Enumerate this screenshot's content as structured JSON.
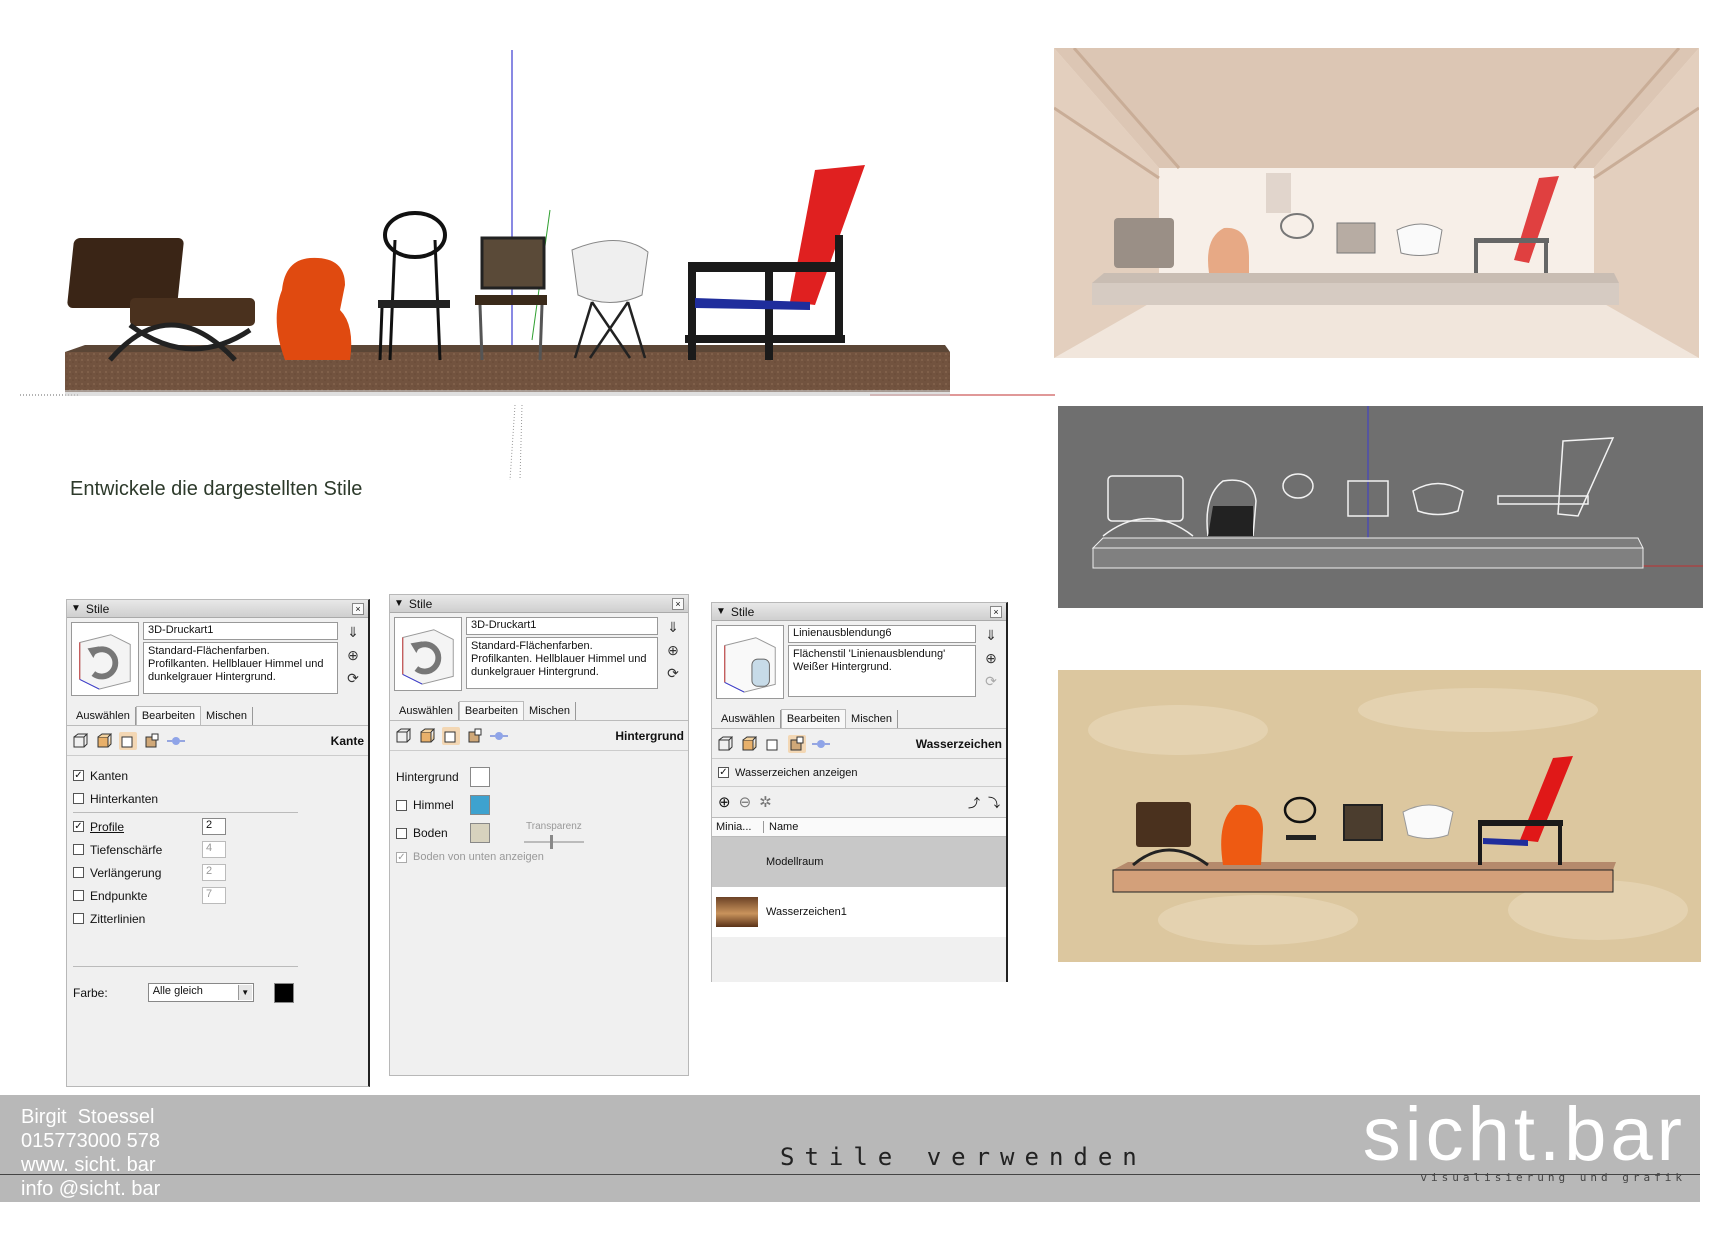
{
  "instruction": "Entwickele die dargestellten Stile",
  "panels": [
    {
      "title": "Stile",
      "style_name": "3D-Druckart1",
      "description": "Standard-Flächenfarben. Profilkanten. Hellblauer Himmel und dunkelgrauer Hintergrund.",
      "tabs": [
        "Auswählen",
        "Bearbeiten",
        "Mischen"
      ],
      "active_tab": "Bearbeiten",
      "mode": "Kante",
      "options": [
        {
          "label": "Kanten",
          "checked": true,
          "value": ""
        },
        {
          "label": "Hinterkanten",
          "checked": false,
          "value": ""
        },
        {
          "label": "Profile",
          "checked": true,
          "value": "2"
        },
        {
          "label": "Tiefenschärfe",
          "checked": false,
          "value": "4"
        },
        {
          "label": "Verlängerung",
          "checked": false,
          "value": "2"
        },
        {
          "label": "Endpunkte",
          "checked": false,
          "value": "7"
        },
        {
          "label": "Zitterlinien",
          "checked": false,
          "value": ""
        }
      ],
      "color_label": "Farbe:",
      "color_select": "Alle gleich",
      "color_swatch": "#000000"
    },
    {
      "title": "Stile",
      "style_name": "3D-Druckart1",
      "description": "Standard-Flächenfarben. Profilkanten. Hellblauer Himmel und dunkelgrauer Hintergrund.",
      "tabs": [
        "Auswählen",
        "Bearbeiten",
        "Mischen"
      ],
      "active_tab": "Bearbeiten",
      "mode": "Hintergrund",
      "background_label": "Hintergrund",
      "background_color": "#ffffff",
      "sky_label": "Himmel",
      "sky_color": "#3ea2cf",
      "ground_label": "Boden",
      "ground_color": "#d7d2be",
      "transparency_label": "Transparenz",
      "ground_below_label": "Boden von unten anzeigen"
    },
    {
      "title": "Stile",
      "style_name": "Linienausblendung6",
      "description": "Flächenstil 'Linienausblendung' Weißer Hintergrund.",
      "tabs": [
        "Auswählen",
        "Bearbeiten",
        "Mischen"
      ],
      "active_tab": "Bearbeiten",
      "mode": "Wasserzeichen",
      "show_watermarks_label": "Wasserzeichen anzeigen",
      "col_thumb": "Minia...",
      "col_name": "Name",
      "rows": [
        "Modellraum",
        "Wasserzeichen1"
      ]
    }
  ],
  "footer": {
    "contact": [
      "Birgit  Stoessel",
      "015773000 578",
      "www. sicht. bar",
      "info @sicht. bar"
    ],
    "slide_title": "Stile verwenden",
    "brand": "sicht.bar",
    "tagline": "visualisierung und grafik"
  },
  "icons": {
    "close": "close-icon",
    "refresh": "refresh-icon",
    "add": "add-icon",
    "remove": "remove-icon",
    "settings": "gear-icon"
  }
}
